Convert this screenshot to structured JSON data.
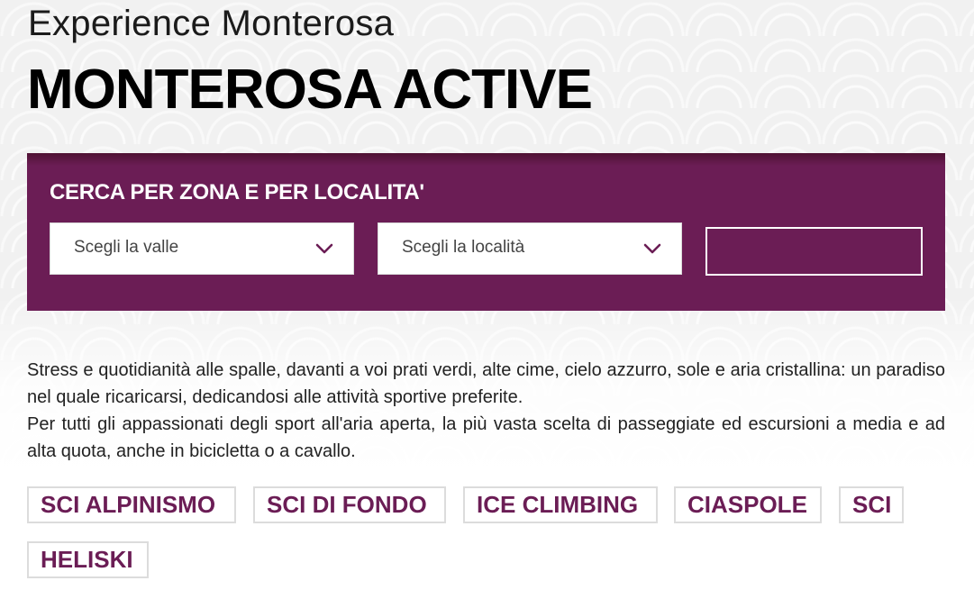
{
  "header": {
    "kicker": "Experience Monterosa",
    "title": "MONTEROSA ACTIVE"
  },
  "search": {
    "title": "CERCA PER ZONA E PER LOCALITA'",
    "valley_select": "Scegli la valle",
    "location_select": "Scegli la località",
    "button_label": ""
  },
  "intro": {
    "paragraph1": "Stress e quotidianità alle spalle, davanti a voi prati verdi, alte cime, cielo azzurro, sole e aria cristallina: un paradiso nel quale ricaricarsi, dedicandosi alle attività sportive preferite.",
    "paragraph2": "Per tutti gli appassionati degli sport all'aria aperta, la più vasta scelta di passeggiate ed escursioni a media e ad alta quota, anche in bicicletta o a cavallo."
  },
  "tags": [
    "SCI ALPINISMO",
    "SCI DI FONDO",
    "ICE CLIMBING",
    "CIASPOLE",
    "SCI",
    "HELISKI"
  ],
  "colors": {
    "brand_purple": "#6b1d55",
    "header_dark": "#4f1233"
  }
}
